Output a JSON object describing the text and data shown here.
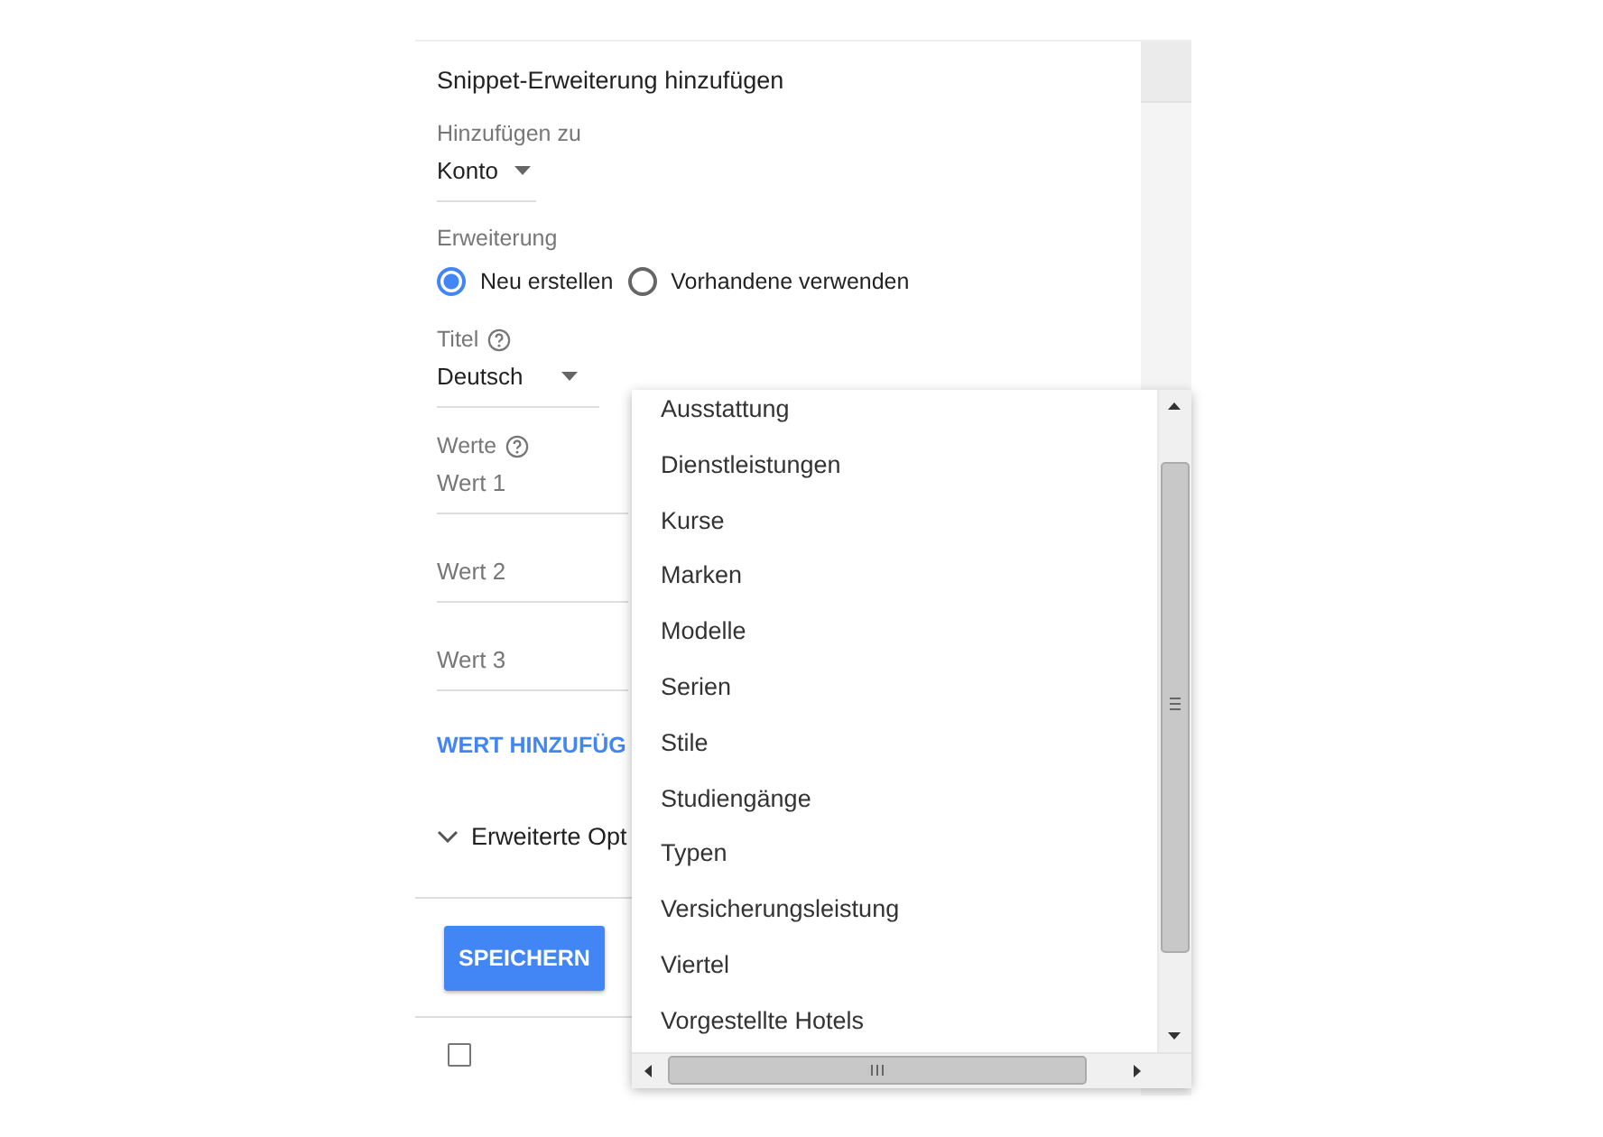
{
  "form": {
    "title": "Snippet-Erweiterung hinzufügen",
    "add_to": {
      "label": "Hinzufügen zu",
      "value": "Konto"
    },
    "extension": {
      "label": "Erweiterung",
      "options": [
        {
          "label": "Neu erstellen",
          "selected": true
        },
        {
          "label": "Vorhandene verwenden",
          "selected": false
        }
      ]
    },
    "title_field": {
      "label": "Titel",
      "value": "Deutsch"
    },
    "values": {
      "label": "Werte",
      "fields": [
        {
          "placeholder": "Wert 1"
        },
        {
          "placeholder": "Wert 2"
        },
        {
          "placeholder": "Wert 3"
        }
      ]
    },
    "add_value_link": "WERT HINZUFÜG",
    "advanced": {
      "label": "Erweiterte Opt",
      "expanded": false
    },
    "save_button": "SPEICHERN",
    "table_row": {
      "checked": false
    }
  },
  "dropdown": {
    "items": [
      {
        "label": "Ausstattung"
      },
      {
        "label": "Dienstleistungen"
      },
      {
        "label": "Kurse"
      },
      {
        "label": "Marken"
      },
      {
        "label": "Modelle"
      },
      {
        "label": "Serien"
      },
      {
        "label": "Stile"
      },
      {
        "label": "Studiengänge"
      },
      {
        "label": "Typen"
      },
      {
        "label": "Versicherungsleistung"
      },
      {
        "label": "Viertel"
      },
      {
        "label": "Vorgestellte Hotels"
      }
    ]
  }
}
